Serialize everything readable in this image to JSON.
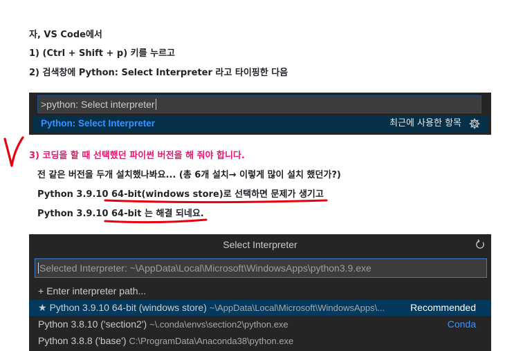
{
  "intro": {
    "line1": "자, VS Code에서",
    "line2": "1) (Ctrl + Shift + p) 키를 누르고",
    "line3": "2) 검색창에 Python: Select Interpreter 라고 타이핑한 다음"
  },
  "palette": {
    "input_value": ">python: Select interpreter",
    "item_label": "Python: Select Interpreter",
    "recently_used": "최근에 사용한 항목"
  },
  "notes": {
    "line1": "3) 코딩을 할 때 선택했던 파이썬 버전을 해 줘야 합니다.",
    "line2": "전 같은 버전을 두개 설치했나봐요... (총 6개 설치→ 이렇게 많이 설치 했던가?)",
    "line3": "Python 3.9.10 64-bit(windows store)로 선택하면 문제가 생기고",
    "line4": "Python 3.9.10 64-bit 는 해결 되네요."
  },
  "interpreter_picker": {
    "title": "Select Interpreter",
    "input_value": "Selected Interpreter: ~\\AppData\\Local\\Microsoft\\WindowsApps\\python3.9.exe",
    "enter_path": "Enter interpreter path...",
    "items": [
      {
        "label": "Python 3.9.10 64-bit (windows store)",
        "path": "~\\AppData\\Local\\Microsoft\\WindowsApps\\...",
        "tag": "Recommended"
      },
      {
        "label": "Python 3.8.10 ('section2')",
        "path": "~\\.conda\\envs\\section2\\python.exe",
        "tag": "Conda"
      },
      {
        "label": "Python 3.8.8 ('base')",
        "path": "C:\\ProgramData\\Anaconda38\\python.exe",
        "tag": ""
      }
    ]
  },
  "colors": {
    "annotation_red": "#e8000e",
    "note_pink": "#e8146e",
    "vscode_bg": "#252526",
    "selection_bg": "#04395e",
    "link_blue": "#3794ff"
  }
}
